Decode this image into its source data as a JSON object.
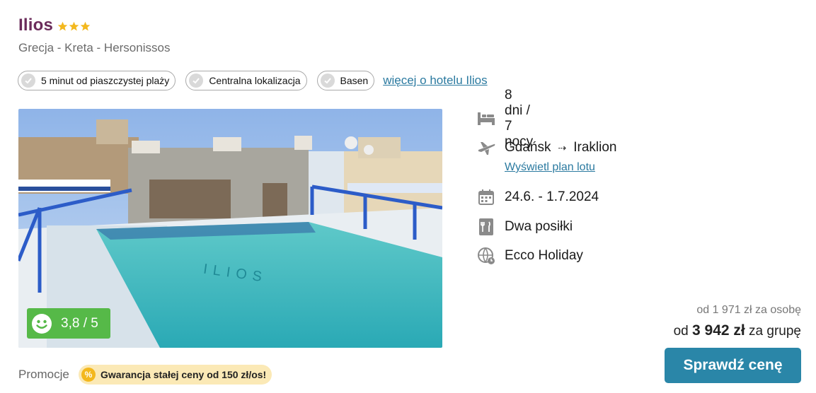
{
  "hotel": {
    "name": "Ilios",
    "stars": 3,
    "location": "Grecja - Kreta - Hersonissos",
    "star_color": "#f3b81e",
    "name_color": "#6b2c5b"
  },
  "features": [
    {
      "label": "5 minut od piaszczystej plaży",
      "icon": "check-icon"
    },
    {
      "label": "Centralna lokalizacja",
      "icon": "check-icon"
    },
    {
      "label": "Basen",
      "icon": "check-icon"
    }
  ],
  "more_link": "więcej o hotelu Ilios",
  "rating": {
    "value": "3,8 / 5",
    "icon": "smiley-icon",
    "color": "#56b948"
  },
  "details": {
    "duration": "8 dni / 7 nocy",
    "flight_from": "Gdańsk",
    "flight_arrow": "⇢",
    "flight_to": "Iraklion",
    "flight_link": "Wyświetl plan lotu",
    "dates": "24.6. - 1.7.2024",
    "board": "Dwa posiłki",
    "operator": "Ecco Holiday"
  },
  "price": {
    "per_person": "od 1 971 zł za osobę",
    "group_prefix": "od",
    "group_amount": "3 942 zł",
    "group_suffix": "za grupę"
  },
  "cta_label": "Sprawdź cenę",
  "cta_color": "#2a86a8",
  "promo": {
    "label": "Promocje",
    "badge": "Gwarancja stałej ceny od 150 zł/os!",
    "icon": "percent-icon"
  }
}
